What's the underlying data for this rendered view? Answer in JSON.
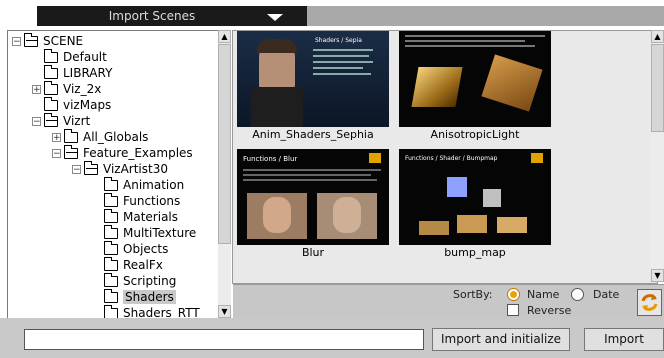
{
  "window": {
    "title": "Import Scenes",
    "dropdown_icon": "triangle-down-icon"
  },
  "tree": {
    "items": [
      {
        "label": "SCENE",
        "expander": "−",
        "open": true
      },
      {
        "label": "Default",
        "expander": "",
        "open": false
      },
      {
        "label": "LIBRARY",
        "expander": "",
        "open": false
      },
      {
        "label": "Viz_2x",
        "expander": "+",
        "open": false
      },
      {
        "label": "vizMaps",
        "expander": "",
        "open": false
      },
      {
        "label": "Vizrt",
        "expander": "−",
        "open": true
      },
      {
        "label": "All_Globals",
        "expander": "+",
        "open": false
      },
      {
        "label": "Feature_Examples",
        "expander": "−",
        "open": true
      },
      {
        "label": "VizArtist30",
        "expander": "−",
        "open": true
      },
      {
        "label": "Animation",
        "expander": "",
        "open": false
      },
      {
        "label": "Functions",
        "expander": "",
        "open": false
      },
      {
        "label": "Materials",
        "expander": "",
        "open": false
      },
      {
        "label": "MultiTexture",
        "expander": "",
        "open": false
      },
      {
        "label": "Objects",
        "expander": "",
        "open": false
      },
      {
        "label": "RealFx",
        "expander": "",
        "open": false
      },
      {
        "label": "Scripting",
        "expander": "",
        "open": false
      },
      {
        "label": "Shaders",
        "expander": "",
        "open": false,
        "selected": true
      },
      {
        "label": "Shaders_RTT",
        "expander": "",
        "open": false
      }
    ]
  },
  "gallery": {
    "items": [
      {
        "name": "Anim_Shaders_Sephia",
        "thumb_title": "Shaders / Sepia"
      },
      {
        "name": "AnisotropicLight",
        "thumb_title": ""
      },
      {
        "name": "Blur",
        "thumb_title": "Functions / Blur"
      },
      {
        "name": "bump_map",
        "thumb_title": "Functions / Shader / Bumpmap"
      }
    ]
  },
  "sort": {
    "label": "SortBy:",
    "options": [
      {
        "label": "Name",
        "selected": true
      },
      {
        "label": "Date",
        "selected": false
      }
    ],
    "reverse_label": "Reverse",
    "reverse_checked": false,
    "refresh_icon": "refresh-icon"
  },
  "bottom": {
    "path_value": "",
    "import_init_label": "Import and initialize",
    "import_label": "Import"
  },
  "colors": {
    "accent": "#f0a000",
    "titlebar": "#1a1a1a"
  }
}
